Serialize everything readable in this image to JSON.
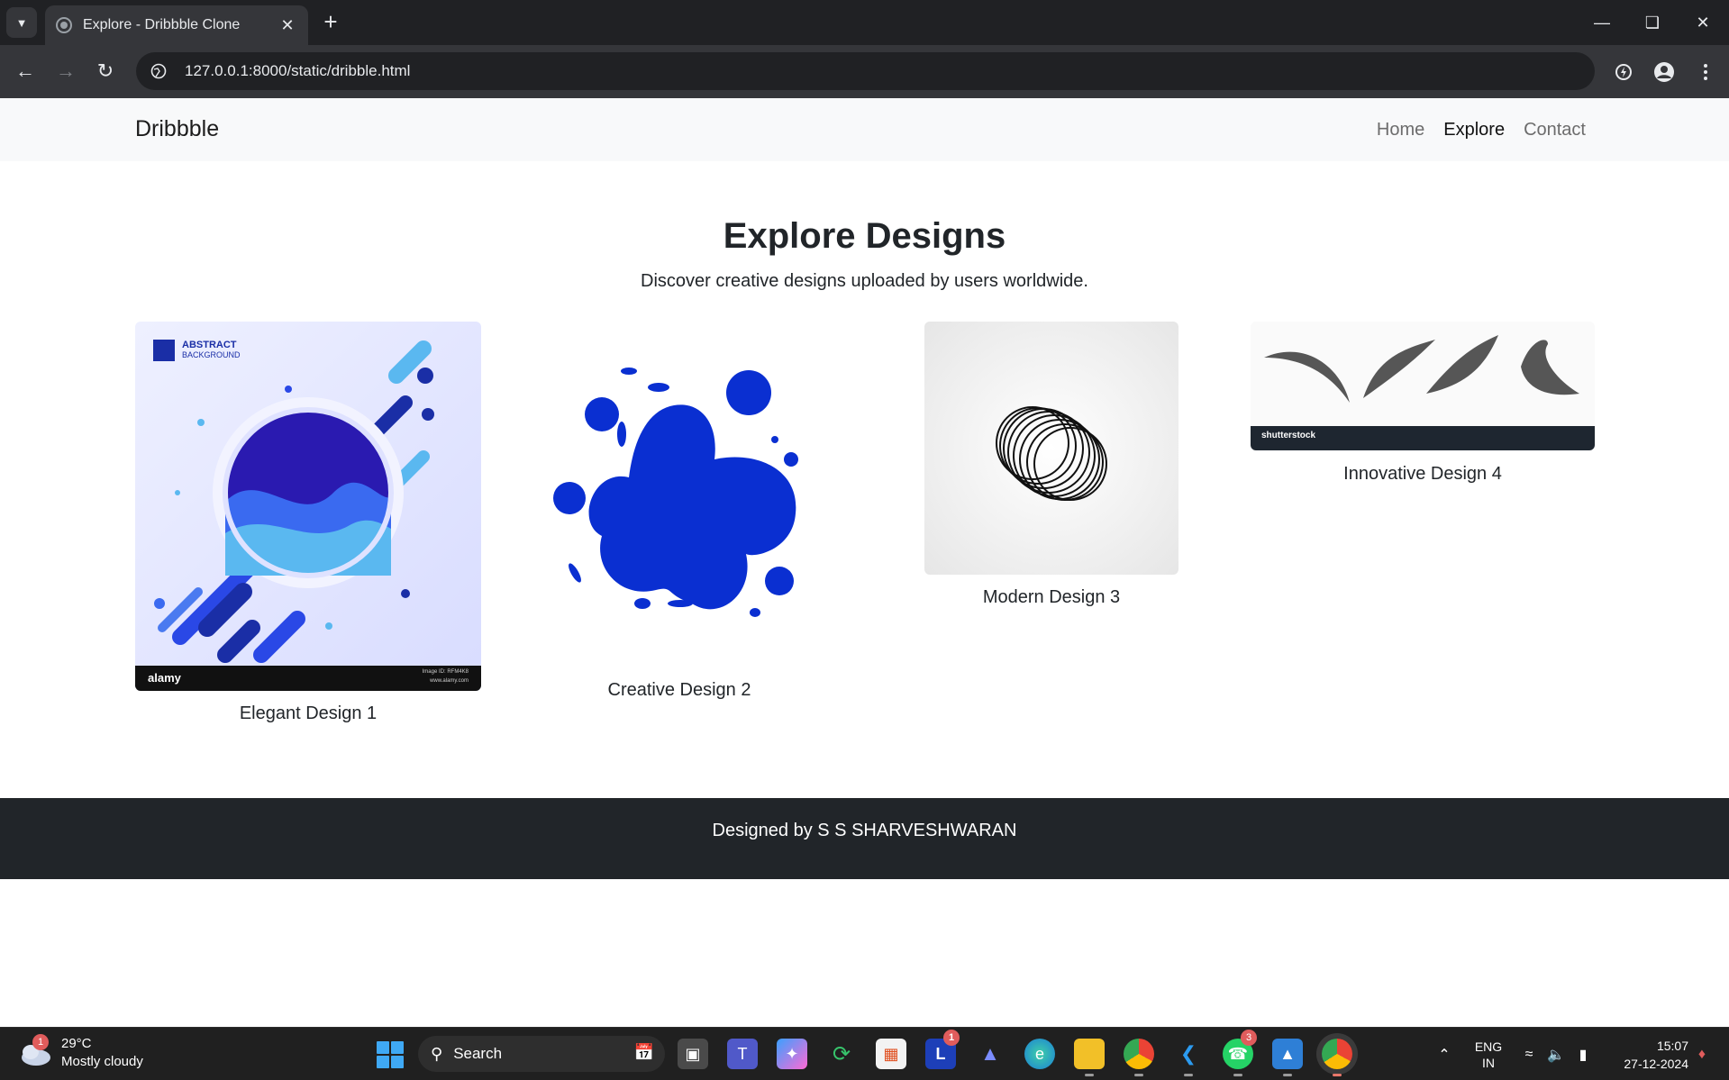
{
  "browser": {
    "tab_title": "Explore - Dribbble Clone",
    "url": "127.0.0.1:8000/static/dribble.html"
  },
  "navbar": {
    "brand": "Dribbble",
    "links": [
      "Home",
      "Explore",
      "Contact"
    ],
    "active": "Explore"
  },
  "main": {
    "title": "Explore Designs",
    "subtitle": "Discover creative designs uploaded by users worldwide.",
    "designs": [
      {
        "caption": "Elegant Design 1",
        "img_title": "ABSTRACT",
        "img_subtitle": "BACKGROUND",
        "watermark": "alamy",
        "img_code": "Image ID: RFM4K8",
        "img_site": "www.alamy.com"
      },
      {
        "caption": "Creative Design 2"
      },
      {
        "caption": "Modern Design 3"
      },
      {
        "caption": "Innovative Design 4",
        "watermark": "shutterstock"
      }
    ]
  },
  "footer": {
    "text": "Designed by S S SHARVESHWARAN"
  },
  "taskbar": {
    "weather_temp": "29°C",
    "weather_desc": "Mostly cloudy",
    "weather_badge": "1",
    "search_label": "Search",
    "app_badge_l": "1",
    "app_badge_whatsapp": "3",
    "lang_line1": "ENG",
    "lang_line2": "IN",
    "time": "15:07",
    "date": "27-12-2024"
  },
  "colors": {
    "accent_blue": "#0a2fd1",
    "footer_bg": "#212529",
    "navbar_bg": "#f8f9fa"
  }
}
